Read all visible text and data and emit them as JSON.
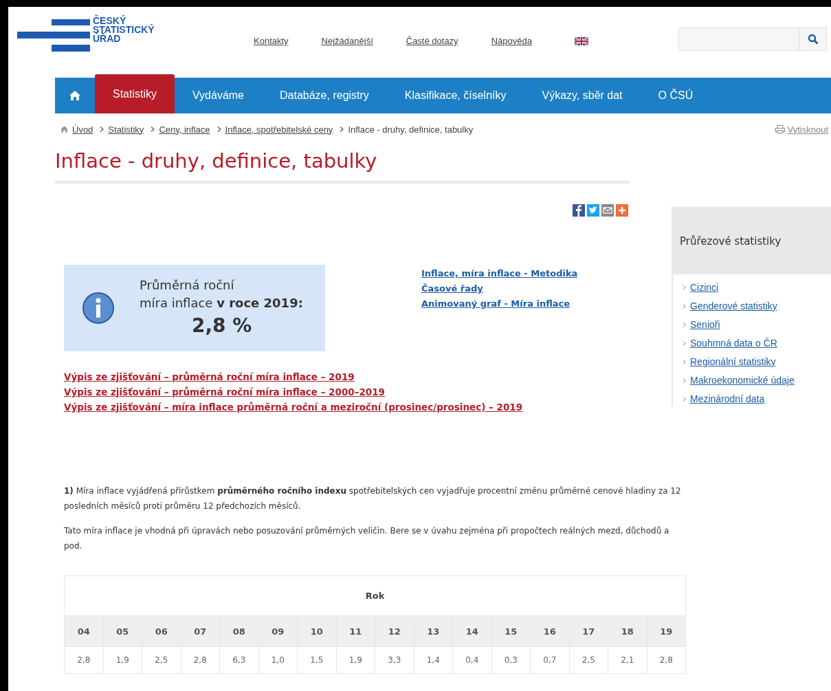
{
  "logo": {
    "text": "ČESKÝ STATISTICKÝ ÚŘAD"
  },
  "top_links": [
    "Kontakty",
    "Nejžádanější",
    "Časté dotazy",
    "Nápověda"
  ],
  "nav": [
    {
      "label": "Statistiky",
      "selected": true
    },
    {
      "label": "Vydáváme",
      "selected": false
    },
    {
      "label": "Databáze, registry",
      "selected": false
    },
    {
      "label": "Klasifikace, číselníky",
      "selected": false
    },
    {
      "label": "Výkazy, sběr dat",
      "selected": false
    },
    {
      "label": "O ČSÚ",
      "selected": false
    }
  ],
  "breadcrumb": {
    "links": [
      "Úvod",
      "Statistiky",
      "Ceny, inflace",
      "Inflace, spotřebitelské ceny"
    ],
    "current": "Inflace - druhy, definice, tabulky"
  },
  "print_link": "Vytisknout",
  "title": "Inflace - druhy, definice, tabulky",
  "info_box": {
    "line1": "Průměrná roční",
    "line2": "míra inflace **v roce 2019:**",
    "value": "2,8 %"
  },
  "side_links": [
    "Inflace, míra inflace - Metodika",
    "Časové řady",
    "Animovaný graf - Míra inflace"
  ],
  "report_links": [
    "Výpis ze zjišťování – průměrná roční míra inflace – 2019",
    "Výpis ze zjišťování – průměrná roční míra inflace – 2000–2019",
    "Výpis ze zjišťování – míra inflace průměrná roční a meziroční (prosinec/prosinec) – 2019"
  ],
  "paragraphs": [
    "**1)** Míra inflace vyjádřená přírůstkem **průměrného ročního indexu** spotřebitelských cen vyjadřuje procentní změnu průměrné cenové hladiny za 12 posledních měsíců proti průměru 12 předchozích měsíců.",
    "Tato míra inflace je vhodná při úpravách nebo posuzování průměrných veličin. Bere se v úvahu zejména při propočtech reálných mezd, důchodů a pod."
  ],
  "table": {
    "header": "Rok",
    "years": [
      "04",
      "05",
      "06",
      "07",
      "08",
      "09",
      "10",
      "11",
      "12",
      "13",
      "14",
      "15",
      "16",
      "17",
      "18",
      "19"
    ],
    "values": [
      "2,8",
      "1,9",
      "2,5",
      "2,8",
      "6,3",
      "1,0",
      "1,5",
      "1,9",
      "3,3",
      "1,4",
      "0,4",
      "0,3",
      "0,7",
      "2,5",
      "2,1",
      "2,8"
    ]
  },
  "sidebar": {
    "title": "Průřezové statistiky",
    "items": [
      "Cizinci",
      "Genderové statistiky",
      "Senioři",
      "Souhmná data o ČR",
      "Regionální statistiky",
      "Makroekonomické údaje",
      "Mezinárodní data"
    ]
  }
}
